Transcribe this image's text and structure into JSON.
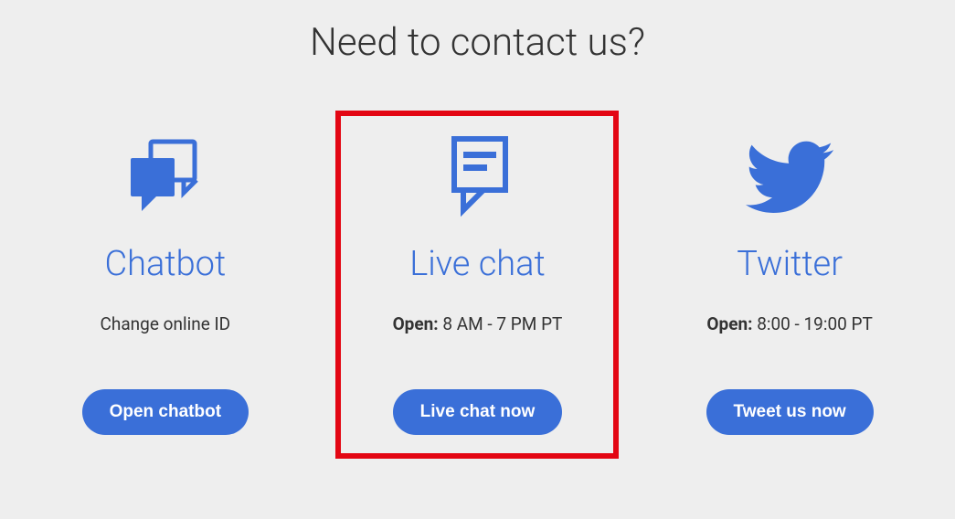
{
  "title": "Need to contact us?",
  "colors": {
    "accent": "#3a6fd8",
    "highlight_border": "#e30613",
    "page_bg": "#eeeeee"
  },
  "cards": {
    "chatbot": {
      "icon": "chat-bubbles-icon",
      "title": "Chatbot",
      "info_prefix": "",
      "info_value": "Change online ID",
      "button": "Open chatbot"
    },
    "livechat": {
      "icon": "speech-page-icon",
      "title": "Live chat",
      "info_prefix": "Open:",
      "info_value": "8 AM - 7 PM PT",
      "button": "Live chat now",
      "highlighted": true
    },
    "twitter": {
      "icon": "twitter-bird-icon",
      "title": "Twitter",
      "info_prefix": "Open:",
      "info_value": "8:00 - 19:00 PT",
      "button": "Tweet us now"
    }
  }
}
